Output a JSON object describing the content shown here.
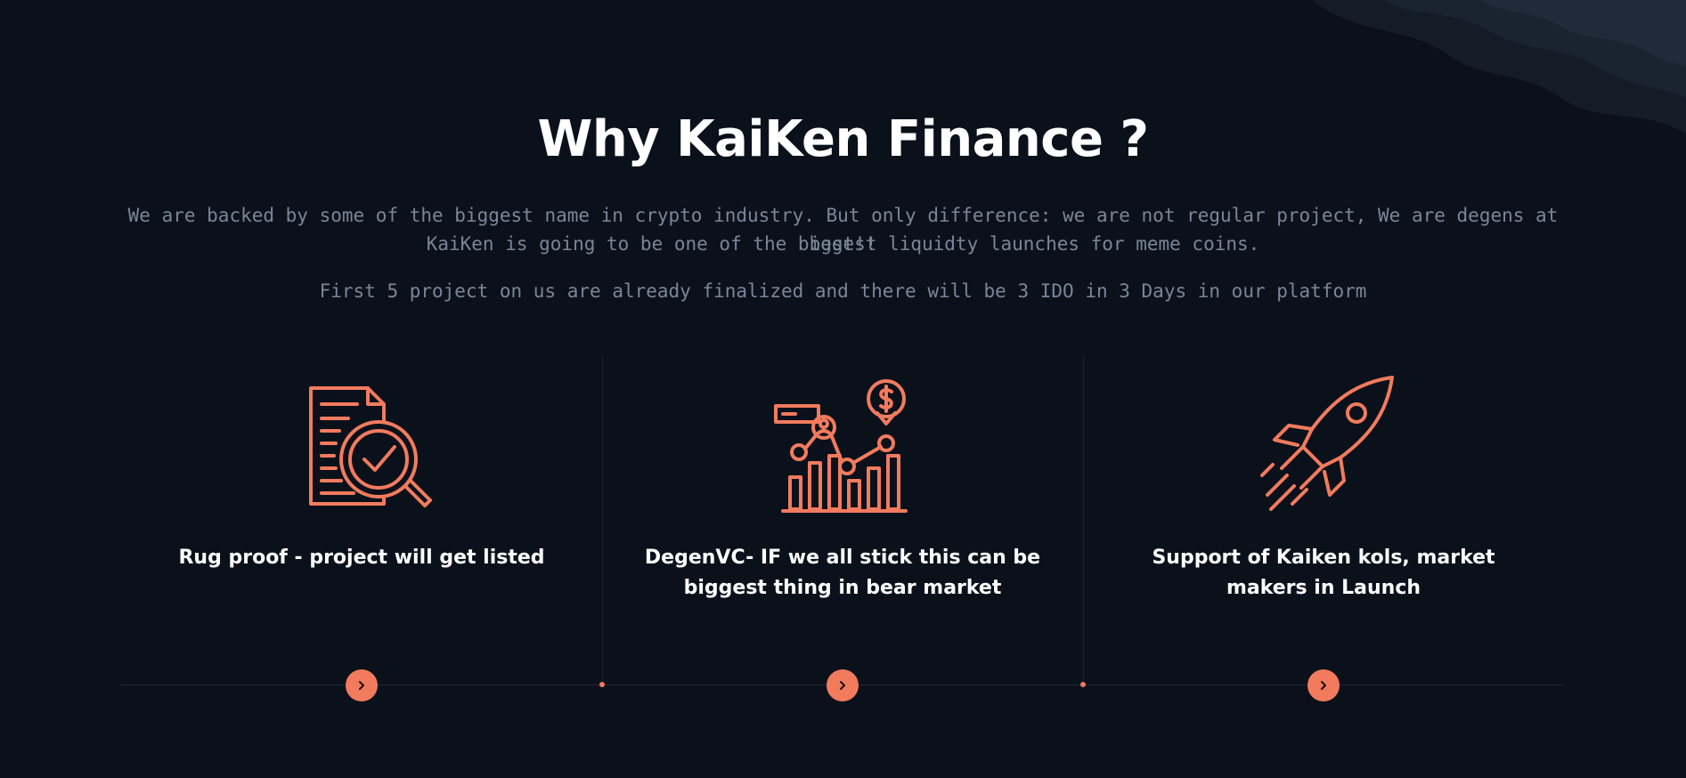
{
  "section": {
    "title": "Why KaiKen Finance ?",
    "description_line1": "We are backed by some of the biggest name in crypto industry. But only difference: we are not regular project, We are degens at best!!",
    "description_line2": "KaiKen is going to be one of the biggest liquidty launches for meme coins.",
    "description_line3": "First 5 project on us are already finalized and there will be 3 IDO in 3 Days in our platform"
  },
  "features": [
    {
      "icon": "document-search-check-icon",
      "label": "Rug proof - project will get listed"
    },
    {
      "icon": "chart-analytics-dollar-icon",
      "label": "DegenVC- IF we all stick this can be biggest thing in bear market"
    },
    {
      "icon": "rocket-icon",
      "label": "Support of Kaiken kols, market makers in Launch"
    }
  ],
  "colors": {
    "background": "#0b111b",
    "accent": "#f27b5e",
    "title": "#ffffff",
    "description": "#7a8697",
    "divider": "#1f2a38"
  }
}
